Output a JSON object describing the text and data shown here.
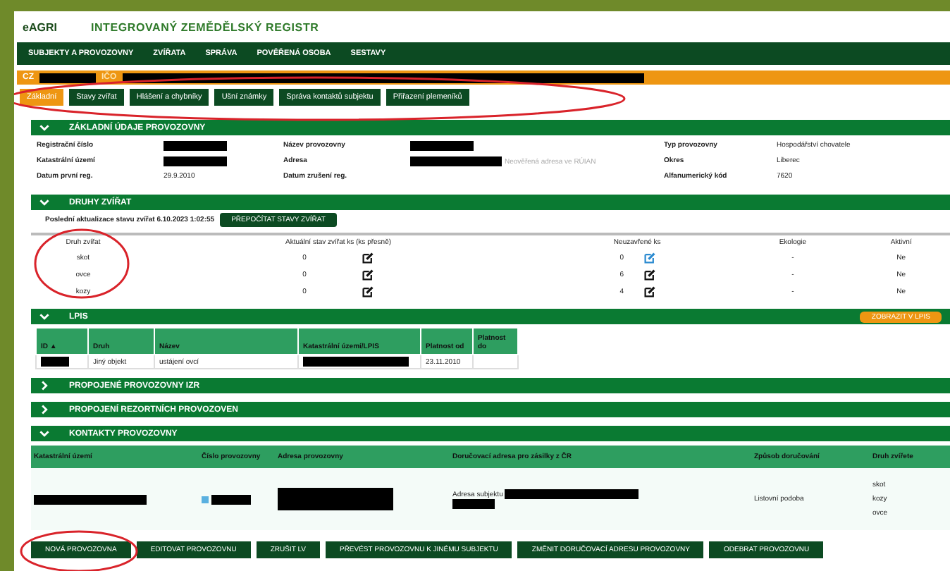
{
  "logo": {
    "brand": "eAGRI",
    "title": "INTEGROVANÝ ZEMĚDĚLSKÝ REGISTR"
  },
  "nav": [
    "SUBJEKTY A PROVOZOVNY",
    "ZVÍŘATA",
    "SPRÁVA",
    "POVĚŘENÁ OSOBA",
    "SESTAVY"
  ],
  "subject_bar": {
    "prefix": "CZ",
    "label": "IČO"
  },
  "tabs": [
    {
      "label": "Základní",
      "selected": true
    },
    {
      "label": "Stavy zvířat",
      "selected": false
    },
    {
      "label": "Hlášení a chybníky",
      "selected": false
    },
    {
      "label": "Ušní známky",
      "selected": false
    },
    {
      "label": "Správa kontaktů subjektu",
      "selected": false
    },
    {
      "label": "Přiřazení plemeníků",
      "selected": false
    }
  ],
  "basic_info": {
    "title": "ZÁKLADNÍ ÚDAJE PROVOZOVNY",
    "expanded": true,
    "fields": [
      {
        "label": "Registrační číslo",
        "redacted": true
      },
      {
        "label": "Název provozovny",
        "redacted": true
      },
      {
        "label": "Typ provozovny",
        "redacted": false,
        "value": "Hospodářství chovatele"
      },
      {
        "label": "Katastrální území",
        "redacted": true
      },
      {
        "label": "Adresa",
        "redacted": true,
        "note": "Neověřená adresa ve RÚIAN"
      },
      {
        "label": "Okres",
        "redacted": false,
        "value": "Liberec"
      },
      {
        "label": "Datum první reg.",
        "redacted": false,
        "value": "29.9.2010"
      },
      {
        "label": "Datum zrušení reg.",
        "redacted": false
      },
      {
        "label": "Alfanumerický kód",
        "redacted": false,
        "value": "7620"
      }
    ]
  },
  "animals": {
    "title": "DRUHY ZVÍŘAT",
    "expanded": true,
    "updated": "Poslední aktualizace stavu zvířat 6.10.2023 1:02:55",
    "button": "PŘEPOČÍTAT STAVY ZVÍŘAT",
    "columns": [
      "Druh zvířat",
      "Aktuální stav zvířat ks (ks přesně)",
      "Neuzavřené ks",
      "Ekologie",
      "Aktivní"
    ],
    "rows": [
      {
        "species": "skot",
        "count": "0",
        "open": "0",
        "open_highlighted": true,
        "eco": "-",
        "active": "Ne"
      },
      {
        "species": "ovce",
        "count": "0",
        "open": "6",
        "open_highlighted": false,
        "eco": "-",
        "active": "Ne"
      },
      {
        "species": "kozy",
        "count": "0",
        "open": "4",
        "open_highlighted": false,
        "eco": "-",
        "active": "Ne"
      }
    ]
  },
  "lpis": {
    "title": "LPIS",
    "expanded": true,
    "button": "ZOBRAZIT V LPIS",
    "columns": [
      "ID ▲",
      "Druh",
      "Název",
      "Katastrální území/LPIS",
      "Platnost od",
      "Platnost do"
    ],
    "rows": [
      {
        "id_redacted": true,
        "kind": "Jiný objekt",
        "name": "ustájení ovcí",
        "area_redacted": true,
        "from": "23.11.2010"
      }
    ]
  },
  "collapsed_sections": [
    {
      "title": "PROPOJENÉ PROVOZOVNY IZR",
      "expanded": false
    },
    {
      "title": "PROPOJENÍ REZORTNÍCH PROVOZOVEN",
      "expanded": false
    }
  ],
  "contacts": {
    "title": "KONTAKTY PROVOZOVNY",
    "expanded": true,
    "columns": [
      "Katastrální území",
      "Číslo provozovny",
      "Adresa provozovny",
      "Doručovací adresa pro zásilky z ČR",
      "Způsob doručování",
      "Druh zvířete"
    ],
    "row": {
      "address_label": "Adresa subjektu",
      "delivery": "Listovní podoba",
      "species": [
        "skot",
        "kozy",
        "ovce"
      ]
    }
  },
  "bottom_buttons": [
    "NOVÁ PROVOZOVNA",
    "EDITOVAT PROVOZOVNU",
    "ZRUŠIT LV",
    "PŘEVÉST PROVOZOVNU K JINÉMU SUBJEKTU",
    "ZMĚNIT DORUČOVACÍ ADRESU PROVOZOVNY",
    "ODEBRAT PROVOZOVNU"
  ],
  "highlights": [
    {
      "kind": "ellipse"
    },
    {
      "kind": "ellipse"
    },
    {
      "kind": "ellipse"
    }
  ]
}
